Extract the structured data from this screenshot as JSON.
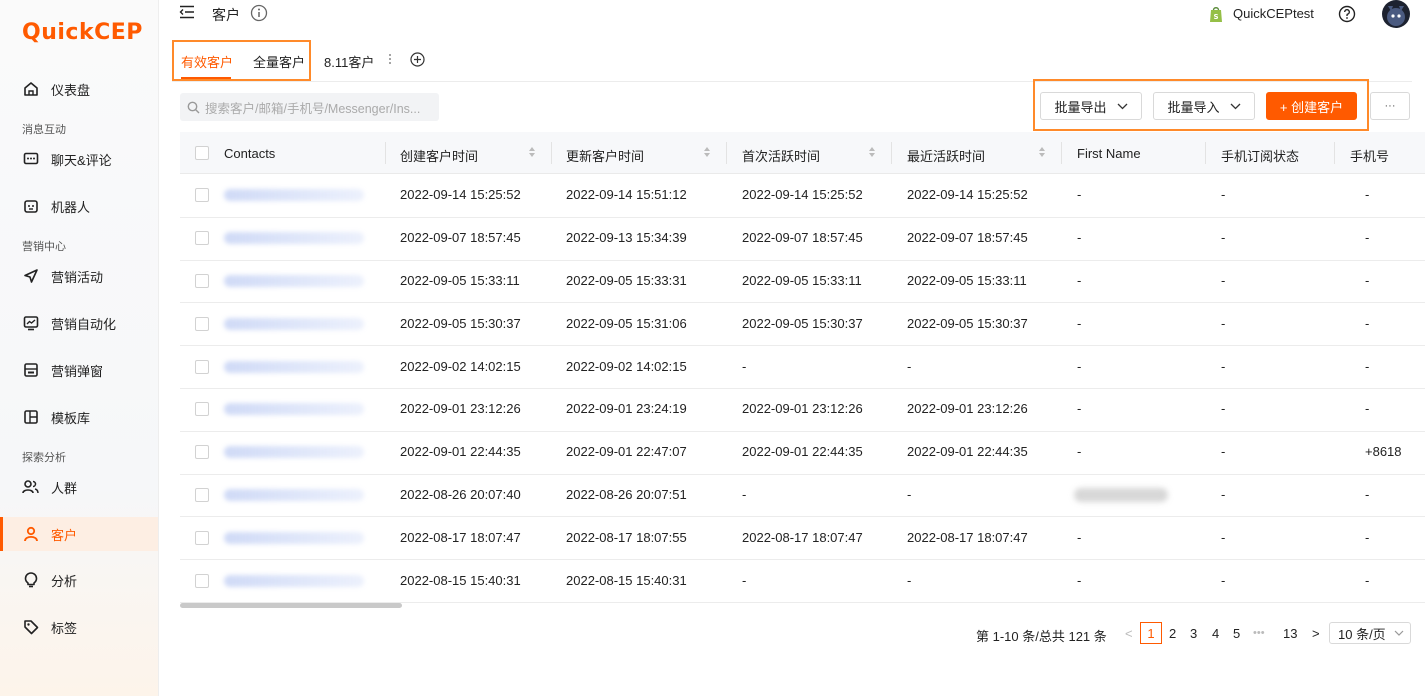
{
  "brand": {
    "logo": "QuickCEP",
    "accent": "#ff5a00"
  },
  "sidebar": {
    "groups": {
      "message": "消息互动",
      "marketing": "营销中心",
      "explore": "探索分析"
    },
    "items": [
      {
        "label": "仪表盘",
        "icon": "home-icon"
      },
      {
        "label": "聊天&评论",
        "icon": "chat-icon"
      },
      {
        "label": "机器人",
        "icon": "robot-icon"
      },
      {
        "label": "营销活动",
        "icon": "send-icon"
      },
      {
        "label": "营销自动化",
        "icon": "monitor-icon"
      },
      {
        "label": "营销弹窗",
        "icon": "popup-icon"
      },
      {
        "label": "模板库",
        "icon": "template-icon"
      },
      {
        "label": "人群",
        "icon": "group-icon"
      },
      {
        "label": "客户",
        "icon": "user-icon",
        "active": true
      },
      {
        "label": "分析",
        "icon": "bulb-icon"
      },
      {
        "label": "标签",
        "icon": "tag-icon"
      }
    ]
  },
  "header": {
    "title": "客户",
    "store": "QuickCEPtest"
  },
  "tabs": [
    {
      "label": "有效客户"
    },
    {
      "label": "全量客户"
    },
    {
      "label": "8.11客户"
    }
  ],
  "search": {
    "placeholder": "搜索客户/邮箱/手机号/Messenger/Ins..."
  },
  "actions": {
    "export": "批量导出",
    "import": "批量导入",
    "create": "+ 创建客户",
    "more": "···"
  },
  "table": {
    "columns": [
      "Contacts",
      "创建客户时间",
      "更新客户时间",
      "首次活跃时间",
      "最近活跃时间",
      "First Name",
      "手机订阅状态",
      "手机号"
    ],
    "rows": [
      {
        "created": "2022-09-14 15:25:52",
        "updated": "2022-09-14 15:51:12",
        "first": "2022-09-14 15:25:52",
        "last": "2022-09-14 15:25:52",
        "fname": "-",
        "sub": "-",
        "phone": "-"
      },
      {
        "created": "2022-09-07 18:57:45",
        "updated": "2022-09-13 15:34:39",
        "first": "2022-09-07 18:57:45",
        "last": "2022-09-07 18:57:45",
        "fname": "-",
        "sub": "-",
        "phone": "-"
      },
      {
        "created": "2022-09-05 15:33:11",
        "updated": "2022-09-05 15:33:31",
        "first": "2022-09-05 15:33:11",
        "last": "2022-09-05 15:33:11",
        "fname": "-",
        "sub": "-",
        "phone": "-"
      },
      {
        "created": "2022-09-05 15:30:37",
        "updated": "2022-09-05 15:31:06",
        "first": "2022-09-05 15:30:37",
        "last": "2022-09-05 15:30:37",
        "fname": "-",
        "sub": "-",
        "phone": "-"
      },
      {
        "created": "2022-09-02 14:02:15",
        "updated": "2022-09-02 14:02:15",
        "first": "-",
        "last": "-",
        "fname": "-",
        "sub": "-",
        "phone": "-"
      },
      {
        "created": "2022-09-01 23:12:26",
        "updated": "2022-09-01 23:24:19",
        "first": "2022-09-01 23:12:26",
        "last": "2022-09-01 23:12:26",
        "fname": "-",
        "sub": "-",
        "phone": "-"
      },
      {
        "created": "2022-09-01 22:44:35",
        "updated": "2022-09-01 22:47:07",
        "first": "2022-09-01 22:44:35",
        "last": "2022-09-01 22:44:35",
        "fname": "-",
        "sub": "-",
        "phone": "+8618"
      },
      {
        "created": "2022-08-26 20:07:40",
        "updated": "2022-08-26 20:07:51",
        "first": "-",
        "last": "-",
        "fname": "",
        "sub": "-",
        "phone": "-"
      },
      {
        "created": "2022-08-17 18:07:47",
        "updated": "2022-08-17 18:07:55",
        "first": "2022-08-17 18:07:47",
        "last": "2022-08-17 18:07:47",
        "fname": "-",
        "sub": "-",
        "phone": "-"
      },
      {
        "created": "2022-08-15 15:40:31",
        "updated": "2022-08-15 15:40:31",
        "first": "-",
        "last": "-",
        "fname": "-",
        "sub": "-",
        "phone": "-"
      }
    ]
  },
  "pagination": {
    "total": "第 1-10 条/总共 121 条",
    "prev": "<",
    "pages": [
      "1",
      "2",
      "3",
      "4",
      "5"
    ],
    "ellipsis": "•••",
    "last": "13",
    "next": ">",
    "size": "10 条/页"
  }
}
